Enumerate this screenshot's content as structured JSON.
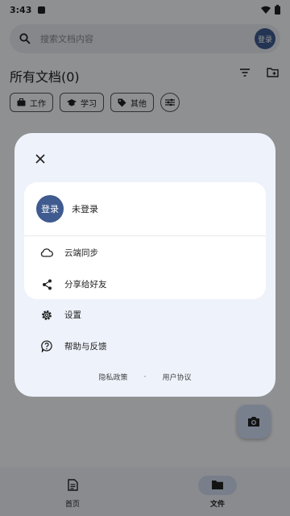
{
  "status_bar": {
    "time": "3:43"
  },
  "search": {
    "placeholder": "搜索文档内容",
    "avatar_label": "登录"
  },
  "docs": {
    "title": "所有文档(0)"
  },
  "chips": [
    {
      "label": "工作",
      "icon": "briefcase-icon"
    },
    {
      "label": "学习",
      "icon": "graduation-cap-icon"
    },
    {
      "label": "其他",
      "icon": "tag-icon"
    }
  ],
  "dialog": {
    "account": {
      "avatar_label": "登录",
      "name": "未登录"
    },
    "menu": {
      "cloud_sync": "云端同步",
      "share": "分享给好友",
      "settings": "设置",
      "help": "帮助与反馈"
    },
    "footer": {
      "privacy": "隐私政策",
      "separator": "·",
      "terms": "用户协议"
    }
  },
  "bottom_nav": {
    "home": "首页",
    "files": "文件",
    "active": "files"
  }
}
